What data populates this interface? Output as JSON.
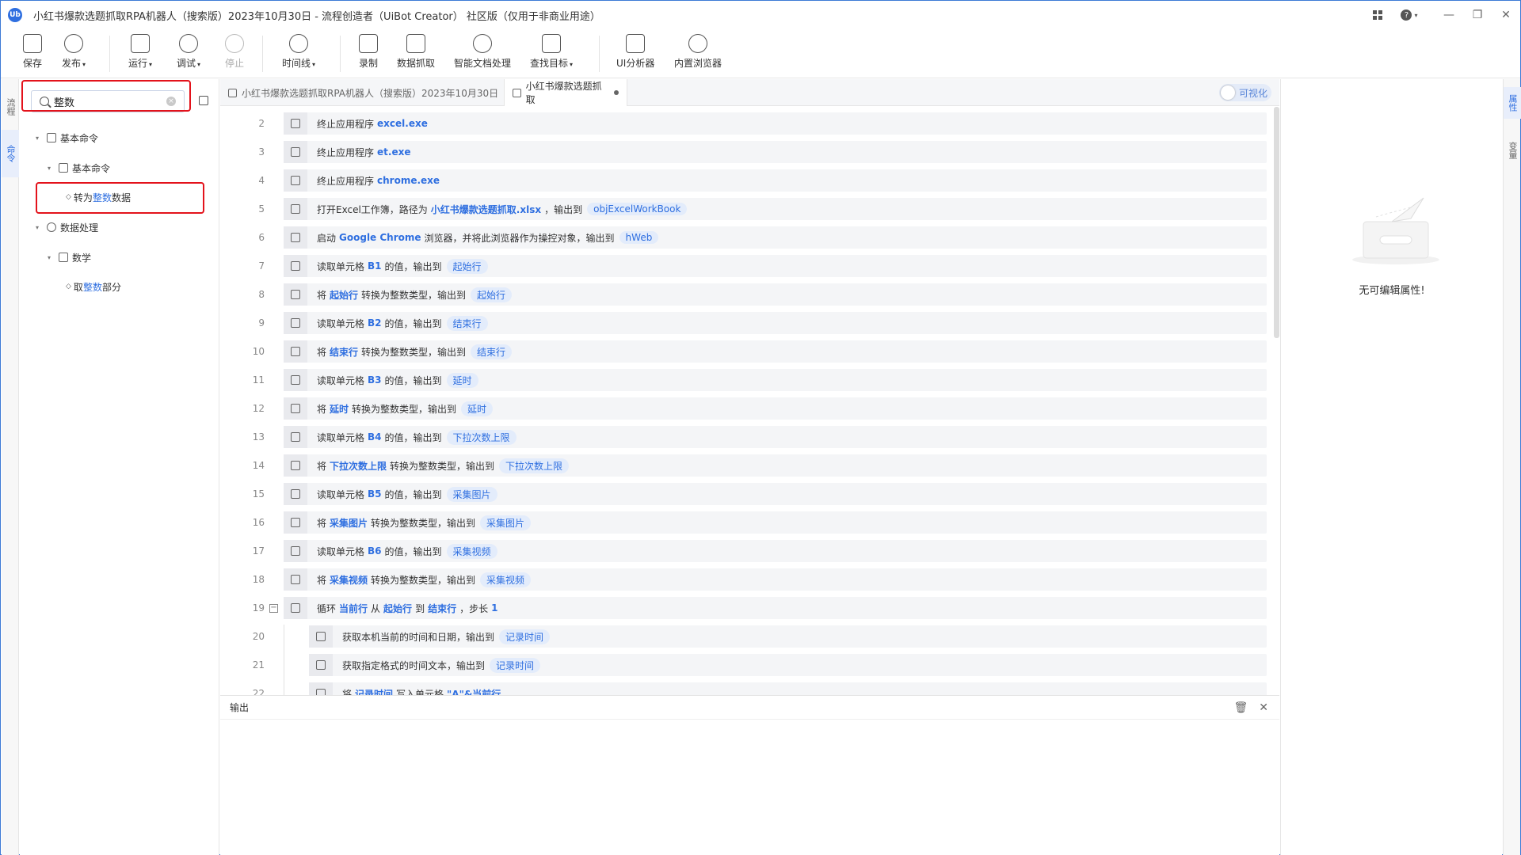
{
  "window": {
    "title": "小红书爆款选题抓取RPA机器人（搜索版）2023年10月30日 - 流程创造者（UiBot Creator） 社区版（仅用于非商业用途）",
    "logo": "Ub",
    "help": "?",
    "minimize": "—",
    "restore": "❐",
    "close": "✕"
  },
  "toolbar": {
    "save": "保存",
    "publish": "发布",
    "run": "运行",
    "debug": "调试",
    "stop": "停止",
    "timeline": "时间线",
    "record": "录制",
    "data_scrape": "数据抓取",
    "smart_doc": "智能文档处理",
    "find_target": "查找目标",
    "ui_analyzer": "UI分析器",
    "builtin_browser": "内置浏览器",
    "caret": "▾"
  },
  "left_rail": {
    "flow": "流程",
    "commands": "命令"
  },
  "right_rail": {
    "props": "属性",
    "vars": "变量"
  },
  "search": {
    "value": "整数",
    "clear": "×"
  },
  "tree": {
    "basic_commands": "基本命令",
    "basic_commands_sub": "基本命令",
    "item1_pre": "转为",
    "item1_hl": "整数",
    "item1_post": "数据",
    "data_processing": "数据处理",
    "math": "数学",
    "item2_pre": "取",
    "item2_hl": "整数",
    "item2_post": "部分",
    "expand": "▾",
    "diamond": "◇"
  },
  "tabs": {
    "tab1": "小红书爆款选题抓取RPA机器人（搜索版）2023年10月30日",
    "tab2": "小红书爆款选题抓取",
    "visual_toggle": "可视化"
  },
  "code_lines": [
    {
      "n": "2",
      "parts": [
        [
          "t",
          "终止应用程序"
        ],
        [
          "k",
          "excel.exe"
        ]
      ]
    },
    {
      "n": "3",
      "parts": [
        [
          "t",
          "终止应用程序"
        ],
        [
          "k",
          "et.exe"
        ]
      ]
    },
    {
      "n": "4",
      "parts": [
        [
          "t",
          "终止应用程序"
        ],
        [
          "k",
          "chrome.exe"
        ]
      ]
    },
    {
      "n": "5",
      "parts": [
        [
          "t",
          "打开Excel工作簿，路径为"
        ],
        [
          "k",
          "小红书爆款选题抓取.xlsx"
        ],
        [
          "t",
          "，输出到"
        ],
        [
          "v",
          "objExcelWorkBook"
        ]
      ]
    },
    {
      "n": "6",
      "parts": [
        [
          "t",
          "启动"
        ],
        [
          "k",
          "Google Chrome"
        ],
        [
          "t",
          "浏览器，并将此浏览器作为操控对象，输出到"
        ],
        [
          "v",
          "hWeb"
        ]
      ]
    },
    {
      "n": "7",
      "parts": [
        [
          "t",
          "读取单元格"
        ],
        [
          "k",
          "B1"
        ],
        [
          "t",
          "的值，输出到"
        ],
        [
          "v",
          "起始行"
        ]
      ]
    },
    {
      "n": "8",
      "parts": [
        [
          "t",
          "将"
        ],
        [
          "k",
          "起始行"
        ],
        [
          "t",
          "转换为整数类型，输出到"
        ],
        [
          "v",
          "起始行"
        ]
      ]
    },
    {
      "n": "9",
      "parts": [
        [
          "t",
          "读取单元格"
        ],
        [
          "k",
          "B2"
        ],
        [
          "t",
          "的值，输出到"
        ],
        [
          "v",
          "结束行"
        ]
      ]
    },
    {
      "n": "10",
      "parts": [
        [
          "t",
          "将"
        ],
        [
          "k",
          "结束行"
        ],
        [
          "t",
          "转换为整数类型，输出到"
        ],
        [
          "v",
          "结束行"
        ]
      ]
    },
    {
      "n": "11",
      "parts": [
        [
          "t",
          "读取单元格"
        ],
        [
          "k",
          "B3"
        ],
        [
          "t",
          "的值，输出到"
        ],
        [
          "v",
          "延时"
        ]
      ]
    },
    {
      "n": "12",
      "parts": [
        [
          "t",
          "将"
        ],
        [
          "k",
          "延时"
        ],
        [
          "t",
          "转换为整数类型，输出到"
        ],
        [
          "v",
          "延时"
        ]
      ]
    },
    {
      "n": "13",
      "parts": [
        [
          "t",
          "读取单元格"
        ],
        [
          "k",
          "B4"
        ],
        [
          "t",
          "的值，输出到"
        ],
        [
          "v",
          "下拉次数上限"
        ]
      ]
    },
    {
      "n": "14",
      "parts": [
        [
          "t",
          "将"
        ],
        [
          "k",
          "下拉次数上限"
        ],
        [
          "t",
          "转换为整数类型，输出到"
        ],
        [
          "v",
          "下拉次数上限"
        ]
      ]
    },
    {
      "n": "15",
      "parts": [
        [
          "t",
          "读取单元格"
        ],
        [
          "k",
          "B5"
        ],
        [
          "t",
          "的值，输出到"
        ],
        [
          "v",
          "采集图片"
        ]
      ]
    },
    {
      "n": "16",
      "parts": [
        [
          "t",
          "将"
        ],
        [
          "k",
          "采集图片"
        ],
        [
          "t",
          "转换为整数类型，输出到"
        ],
        [
          "v",
          "采集图片"
        ]
      ]
    },
    {
      "n": "17",
      "parts": [
        [
          "t",
          "读取单元格"
        ],
        [
          "k",
          "B6"
        ],
        [
          "t",
          "的值，输出到"
        ],
        [
          "v",
          "采集视频"
        ]
      ]
    },
    {
      "n": "18",
      "parts": [
        [
          "t",
          "将"
        ],
        [
          "k",
          "采集视频"
        ],
        [
          "t",
          "转换为整数类型，输出到"
        ],
        [
          "v",
          "采集视频"
        ]
      ]
    },
    {
      "n": "19",
      "parts": [
        [
          "t",
          "循环"
        ],
        [
          "k",
          "当前行"
        ],
        [
          "t",
          "从"
        ],
        [
          "k",
          "起始行"
        ],
        [
          "t",
          "到"
        ],
        [
          "k",
          "结束行"
        ],
        [
          "t",
          "，步长"
        ],
        [
          "k",
          "1"
        ]
      ]
    },
    {
      "n": "20",
      "parts": [
        [
          "t",
          "获取本机当前的时间和日期，输出到"
        ],
        [
          "v",
          "记录时间"
        ]
      ]
    },
    {
      "n": "21",
      "parts": [
        [
          "t",
          "获取指定格式的时间文本，输出到"
        ],
        [
          "v",
          "记录时间"
        ]
      ]
    },
    {
      "n": "22",
      "parts": [
        [
          "t",
          "将"
        ],
        [
          "k",
          "记录时间"
        ],
        [
          "t",
          "写入单元格"
        ],
        [
          "k",
          "\"A\"&当前行"
        ]
      ]
    }
  ],
  "output": {
    "label": "输出",
    "trash": "🗑",
    "close": "✕"
  },
  "property": {
    "empty": "无可编辑属性!"
  }
}
